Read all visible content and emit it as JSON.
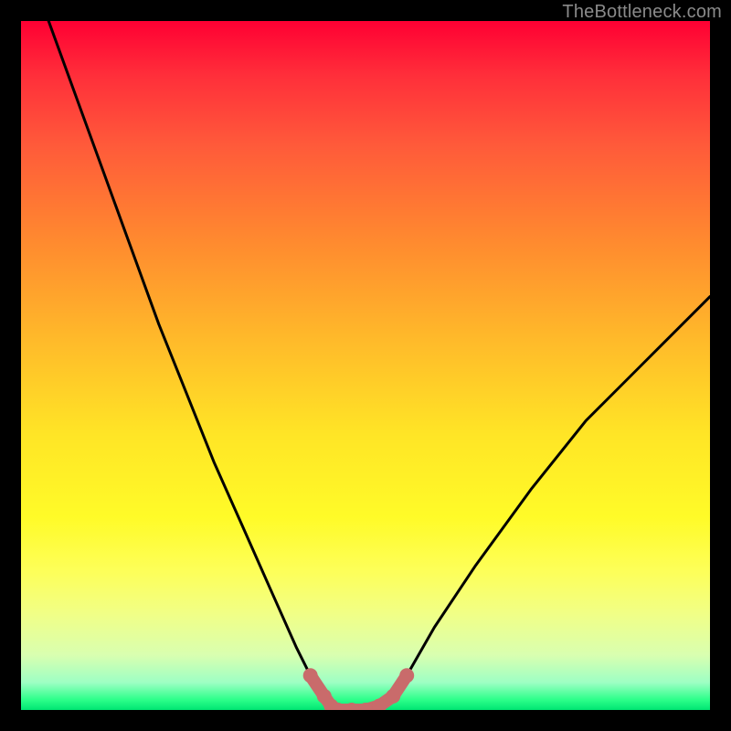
{
  "watermark": "TheBottleneck.com",
  "chart_data": {
    "type": "line",
    "title": "",
    "xlabel": "",
    "ylabel": "",
    "xlim": [
      0,
      100
    ],
    "ylim": [
      0,
      100
    ],
    "series": [
      {
        "name": "bottleneck-curve",
        "x": [
          4,
          8,
          12,
          16,
          20,
          24,
          28,
          32,
          36,
          40,
          42,
          44,
          45,
          46,
          48,
          50,
          52,
          54,
          56,
          60,
          66,
          74,
          82,
          90,
          100
        ],
        "y": [
          100,
          89,
          78,
          67,
          56,
          46,
          36,
          27,
          18,
          9,
          5,
          2,
          0.6,
          0,
          0,
          0,
          0.6,
          2,
          5,
          12,
          21,
          32,
          42,
          50,
          60
        ]
      },
      {
        "name": "trough-highlight",
        "x": [
          42,
          44,
          45,
          46,
          48,
          50,
          52,
          54,
          56
        ],
        "y": [
          5,
          2,
          0.6,
          0,
          0,
          0,
          0.6,
          2,
          5
        ]
      }
    ],
    "colors": {
      "curve": "#000000",
      "highlight": "#c96b6b"
    }
  }
}
